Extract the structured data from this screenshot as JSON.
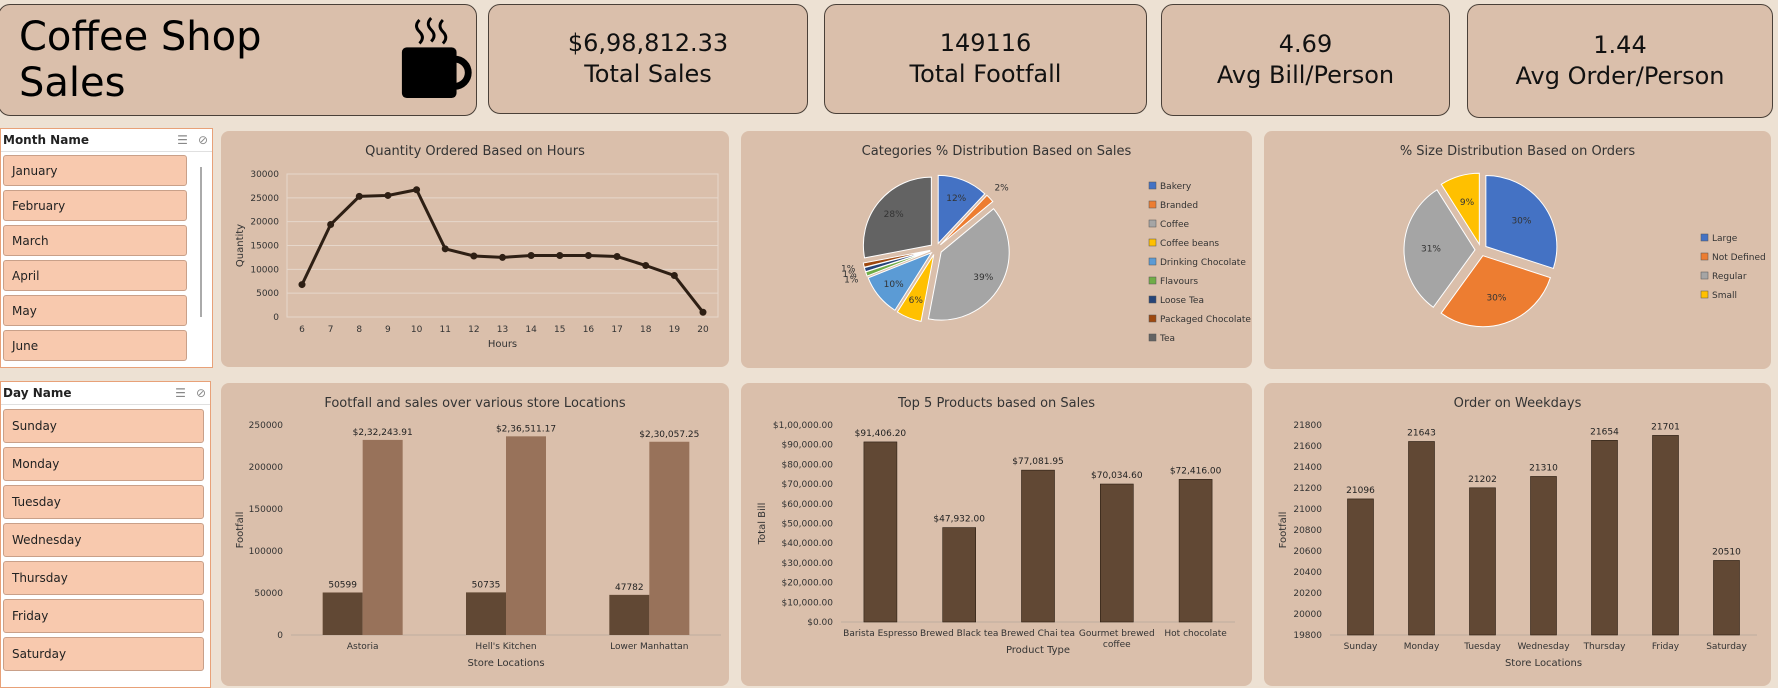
{
  "header": {
    "title": "Coffee Shop Sales",
    "icon": "coffee-cup-icon"
  },
  "kpis": [
    {
      "value": "$6,98,812.33",
      "label": "Total Sales"
    },
    {
      "value": "149116",
      "label": "Total Footfall"
    },
    {
      "value": "4.69",
      "label": "Avg Bill/Person"
    },
    {
      "value": "1.44",
      "label": "Avg Order/Person"
    }
  ],
  "slicers": {
    "month": {
      "title": "Month Name",
      "items": [
        "January",
        "February",
        "March",
        "April",
        "May",
        "June"
      ]
    },
    "day": {
      "title": "Day Name",
      "items": [
        "Sunday",
        "Monday",
        "Tuesday",
        "Wednesday",
        "Thursday",
        "Friday",
        "Saturday"
      ]
    }
  },
  "colors": {
    "bar_dark": "#614834",
    "bar_light": "#98725a",
    "line": "#2e1f14",
    "panel": "#dabfab"
  },
  "chart_data": [
    {
      "type": "line",
      "title": "Quantity Ordered Based on Hours",
      "xlabel": "Hours",
      "ylabel": "Quantity",
      "x": [
        6,
        7,
        8,
        9,
        10,
        11,
        12,
        13,
        14,
        15,
        16,
        17,
        18,
        19,
        20
      ],
      "values": [
        6800,
        19400,
        25300,
        25500,
        26700,
        14300,
        12800,
        12500,
        12900,
        12900,
        12900,
        12700,
        10800,
        8700,
        1000
      ],
      "ylim": [
        0,
        30000
      ],
      "yticks": [
        0,
        5000,
        10000,
        15000,
        20000,
        25000,
        30000
      ],
      "grid": true
    },
    {
      "type": "pie",
      "title": "Categories % Distribution Based on Sales",
      "legend": "right",
      "slices": [
        {
          "name": "Bakery",
          "value": 12,
          "label": "12%",
          "color": "#4472c4"
        },
        {
          "name": "Branded",
          "value": 2,
          "label": "2%",
          "color": "#ed7d31"
        },
        {
          "name": "Coffee",
          "value": 39,
          "label": "39%",
          "color": "#a5a5a5"
        },
        {
          "name": "Coffee beans",
          "value": 6,
          "label": "6%",
          "color": "#ffc000"
        },
        {
          "name": "Drinking Chocolate",
          "value": 10,
          "label": "10%",
          "color": "#5b9bd5"
        },
        {
          "name": "Flavours",
          "value": 1,
          "label": "1%",
          "color": "#70ad47"
        },
        {
          "name": "Loose Tea",
          "value": 1,
          "label": "1%",
          "color": "#264478"
        },
        {
          "name": "Packaged Chocolate",
          "value": 1,
          "label": "1%",
          "color": "#9e480e"
        },
        {
          "name": "Tea",
          "value": 28,
          "label": "28%",
          "color": "#636363"
        }
      ]
    },
    {
      "type": "pie",
      "title": "% Size Distribution Based on Orders",
      "legend": "right",
      "slices": [
        {
          "name": "Large",
          "value": 30,
          "label": "30%",
          "color": "#4472c4"
        },
        {
          "name": "Not Defined",
          "value": 30,
          "label": "30%",
          "color": "#ed7d31"
        },
        {
          "name": "Regular",
          "value": 31,
          "label": "31%",
          "color": "#a5a5a5"
        },
        {
          "name": "Small",
          "value": 9,
          "label": "9%",
          "color": "#ffc000"
        }
      ]
    },
    {
      "type": "bar",
      "title": "Footfall and sales over various store Locations",
      "xlabel": "Store Locations",
      "ylabel": "Footfall",
      "categories": [
        "Astoria",
        "Hell's Kitchen",
        "Lower Manhattan"
      ],
      "series": [
        {
          "values": [
            50599,
            50735,
            47782
          ],
          "labels": [
            "50599",
            "50735",
            "47782"
          ]
        },
        {
          "values": [
            232243.91,
            236511.17,
            230057.25
          ],
          "labels": [
            "$2,32,243.91",
            "$2,36,511.17",
            "$2,30,057.25"
          ]
        }
      ],
      "ylim": [
        0,
        250000
      ],
      "yticks": [
        0,
        50000,
        100000,
        150000,
        200000,
        250000
      ]
    },
    {
      "type": "bar",
      "title": "Top 5 Products based on Sales",
      "xlabel": "Product Type",
      "ylabel": "Total Bill",
      "categories": [
        "Barista Espresso",
        "Brewed Black tea",
        "Brewed Chai tea",
        "Gourmet brewed coffee",
        "Hot chocolate"
      ],
      "values": [
        91406.2,
        47932.0,
        77081.95,
        70034.6,
        72416.0
      ],
      "labels": [
        "$91,406.20",
        "$47,932.00",
        "$77,081.95",
        "$70,034.60",
        "$72,416.00"
      ],
      "ylim": [
        0,
        100000
      ],
      "ytick_labels": [
        "$0.00",
        "$10,000.00",
        "$20,000.00",
        "$30,000.00",
        "$40,000.00",
        "$50,000.00",
        "$60,000.00",
        "$70,000.00",
        "$80,000.00",
        "$90,000.00",
        "$1,00,000.00"
      ]
    },
    {
      "type": "bar",
      "title": "Order on Weekdays",
      "xlabel": "Store Locations",
      "ylabel": "Footfall",
      "categories": [
        "Sunday",
        "Monday",
        "Tuesday",
        "Wednesday",
        "Thursday",
        "Friday",
        "Saturday"
      ],
      "values": [
        21096,
        21643,
        21202,
        21310,
        21654,
        21701,
        20510
      ],
      "ylim": [
        19800,
        21800
      ],
      "yticks": [
        19800,
        20000,
        20200,
        20400,
        20600,
        20800,
        21000,
        21200,
        21400,
        21600,
        21800
      ]
    }
  ]
}
